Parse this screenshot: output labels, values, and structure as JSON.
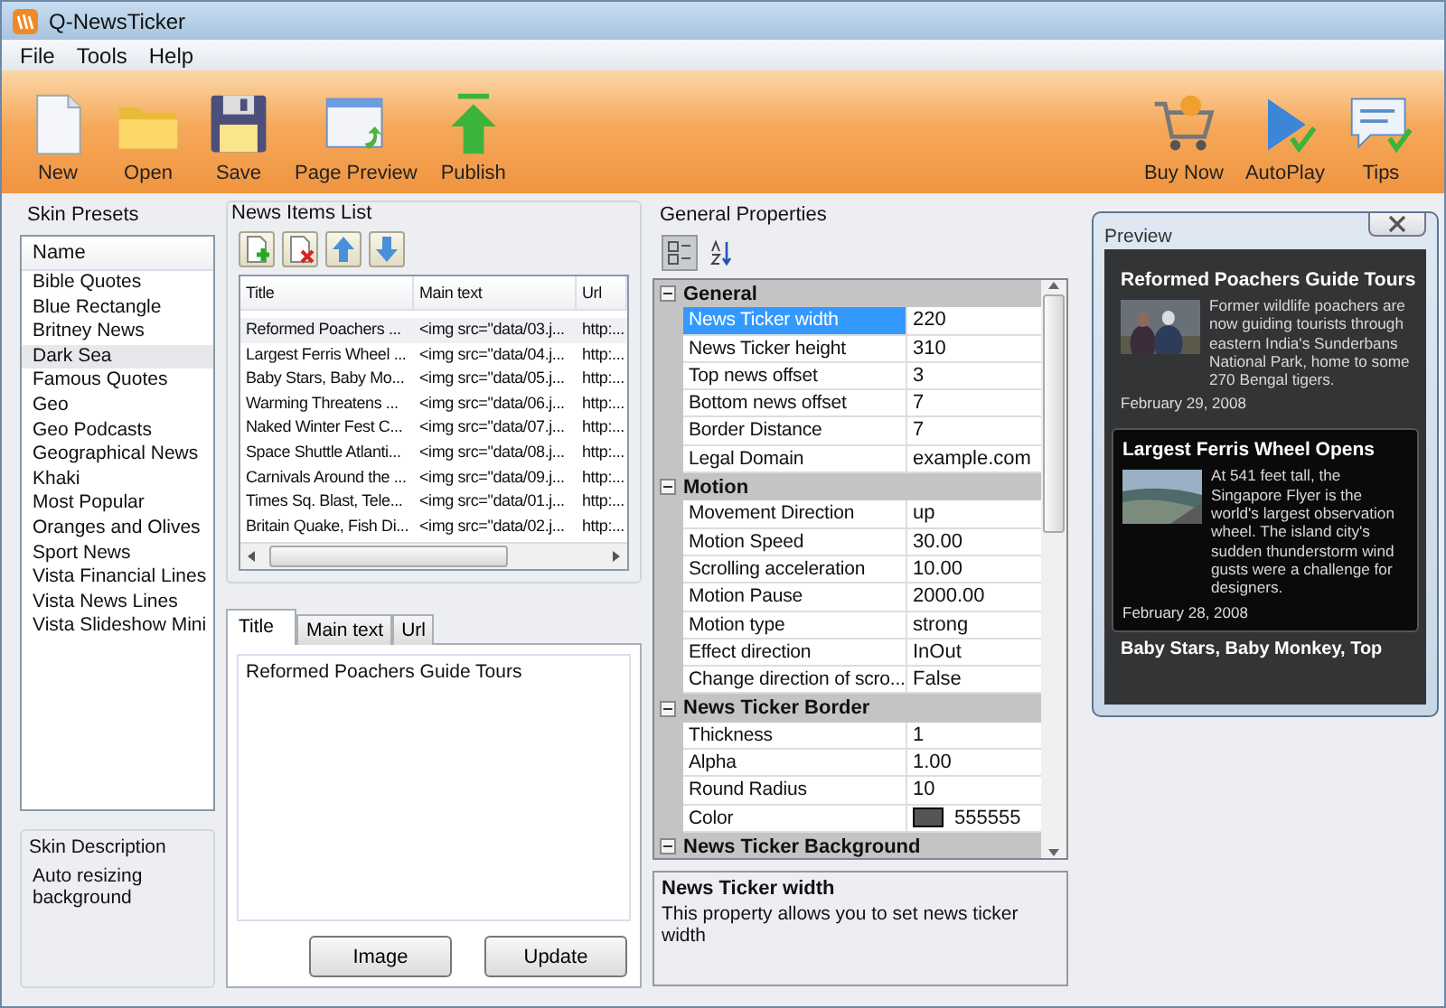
{
  "window": {
    "title": "Q-NewsTicker"
  },
  "menu": [
    "File",
    "Tools",
    "Help"
  ],
  "toolbar_left": [
    {
      "label": "New",
      "kind": "new"
    },
    {
      "label": "Open",
      "kind": "open"
    },
    {
      "label": "Save",
      "kind": "save"
    },
    {
      "label": "Page Preview",
      "kind": "preview"
    },
    {
      "label": "Publish",
      "kind": "publish"
    }
  ],
  "toolbar_right": [
    {
      "label": "Buy Now",
      "kind": "cart"
    },
    {
      "label": "AutoPlay",
      "kind": "play"
    },
    {
      "label": "Tips",
      "kind": "tips"
    }
  ],
  "skin_presets": {
    "title": "Skin Presets",
    "column": "Name",
    "items": [
      {
        "label": "Bible Quotes",
        "selected": false
      },
      {
        "label": "Blue Rectangle",
        "selected": false
      },
      {
        "label": "Britney News",
        "selected": false
      },
      {
        "label": "Dark Sea",
        "selected": true
      },
      {
        "label": "Famous Quotes",
        "selected": false
      },
      {
        "label": "Geo",
        "selected": false
      },
      {
        "label": "Geo Podcasts",
        "selected": false
      },
      {
        "label": "Geographical News",
        "selected": false
      },
      {
        "label": "Khaki",
        "selected": false
      },
      {
        "label": "Most Popular",
        "selected": false
      },
      {
        "label": "Oranges and Olives",
        "selected": false
      },
      {
        "label": "Sport News",
        "selected": false
      },
      {
        "label": "Vista Financial Lines",
        "selected": false
      },
      {
        "label": "Vista News Lines",
        "selected": false
      },
      {
        "label": "Vista Slideshow Mini",
        "selected": false
      }
    ],
    "description_title": "Skin Description",
    "description": "Auto resizing background"
  },
  "news_items": {
    "title": "News Items List",
    "columns": [
      "Title",
      "Main text",
      "Url"
    ],
    "rows": [
      {
        "cells": [
          "Reformed Poachers ...",
          "<img src=\"data/03.j...",
          "http:..."
        ],
        "selected": true
      },
      {
        "cells": [
          "Largest Ferris Wheel ...",
          "<img src=\"data/04.j...",
          "http:..."
        ],
        "selected": false
      },
      {
        "cells": [
          "Baby Stars, Baby Mo...",
          "<img src=\"data/05.j...",
          "http:..."
        ],
        "selected": false
      },
      {
        "cells": [
          "Warming Threatens ...",
          "<img src=\"data/06.j...",
          "http:..."
        ],
        "selected": false
      },
      {
        "cells": [
          "Naked Winter Fest C...",
          "<img src=\"data/07.j...",
          "http:..."
        ],
        "selected": false
      },
      {
        "cells": [
          "Space Shuttle Atlanti...",
          "<img src=\"data/08.j...",
          "http:..."
        ],
        "selected": false
      },
      {
        "cells": [
          "Carnivals Around the ...",
          "<img src=\"data/09.j...",
          "http:..."
        ],
        "selected": false
      },
      {
        "cells": [
          "Times Sq. Blast, Tele...",
          "<img src=\"data/01.j...",
          "http:..."
        ],
        "selected": false
      },
      {
        "cells": [
          "Britain Quake, Fish Di...",
          "<img src=\"data/02.j...",
          "http:..."
        ],
        "selected": false
      }
    ]
  },
  "editor": {
    "tabs": [
      {
        "label": "Title",
        "selected": true
      },
      {
        "label": "Main text",
        "selected": false
      },
      {
        "label": "Url",
        "selected": false
      }
    ],
    "value": "Reformed Poachers Guide Tours",
    "buttons": [
      "Image",
      "Update"
    ]
  },
  "properties": {
    "title": "General Properties",
    "categories": [
      {
        "name": "General",
        "expanded": true,
        "rows": [
          {
            "name": "News Ticker width",
            "value": "220",
            "selected": true,
            "kind": "text"
          },
          {
            "name": "News Ticker height",
            "value": "310",
            "selected": false,
            "kind": "text"
          },
          {
            "name": "Top news offset",
            "value": "3",
            "selected": false,
            "kind": "text"
          },
          {
            "name": "Bottom news offset",
            "value": "7",
            "selected": false,
            "kind": "text"
          },
          {
            "name": "Border Distance",
            "value": "7",
            "selected": false,
            "kind": "text"
          },
          {
            "name": "Legal Domain",
            "value": "example.com",
            "selected": false,
            "kind": "text"
          }
        ]
      },
      {
        "name": "Motion",
        "expanded": true,
        "rows": [
          {
            "name": "Movement Direction",
            "value": "up",
            "selected": false,
            "kind": "text"
          },
          {
            "name": "Motion Speed",
            "value": "30.00",
            "selected": false,
            "kind": "text"
          },
          {
            "name": "Scrolling acceleration",
            "value": "10.00",
            "selected": false,
            "kind": "text"
          },
          {
            "name": "Motion Pause",
            "value": "2000.00",
            "selected": false,
            "kind": "text"
          },
          {
            "name": "Motion type",
            "value": "strong",
            "selected": false,
            "kind": "text"
          },
          {
            "name": "Effect direction",
            "value": "InOut",
            "selected": false,
            "kind": "text"
          },
          {
            "name": "Change direction of scro...",
            "value": "False",
            "selected": false,
            "kind": "text"
          }
        ]
      },
      {
        "name": "News Ticker Border",
        "expanded": true,
        "rows": [
          {
            "name": "Thickness",
            "value": "1",
            "selected": false,
            "kind": "text"
          },
          {
            "name": "Alpha",
            "value": "1.00",
            "selected": false,
            "kind": "text"
          },
          {
            "name": "Round Radius",
            "value": "10",
            "selected": false,
            "kind": "text"
          },
          {
            "name": "Color",
            "value": "555555",
            "selected": false,
            "kind": "color",
            "color": "#555555"
          }
        ]
      },
      {
        "name": "News Ticker Background",
        "expanded": true
      }
    ],
    "help_title": "News Ticker width",
    "help_text": "This property allows you to set news ticker width"
  },
  "preview": {
    "title": "Preview",
    "items": [
      {
        "title": "Reformed Poachers Guide Tours",
        "text": "Former wildlife poachers are now guiding tourists through eastern India's Sunderbans National Park, home to some 270 Bengal tigers.",
        "date": "February 29, 2008",
        "selected": false
      },
      {
        "title": "Largest Ferris Wheel Opens",
        "text": "At 541 feet tall, the Singapore Flyer is the world's largest observation wheel. The island city's sudden thunderstorm wind gusts were a challenge for designers.",
        "date": "February 28, 2008",
        "selected": true
      }
    ],
    "next_title": "Baby Stars, Baby Monkey, Top"
  }
}
